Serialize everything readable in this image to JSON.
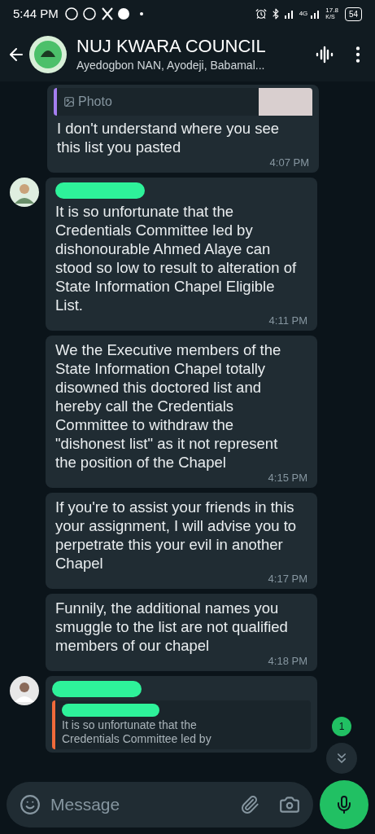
{
  "status_bar": {
    "time": "5:44 PM",
    "network": "4G",
    "speed": "17.8",
    "speed_unit": "K/S",
    "battery": "54"
  },
  "header": {
    "title": "NUJ KWARA COUNCIL",
    "subtitle": "Ayedogbon NAN, Ayodeji, Babamal..."
  },
  "messages": [
    {
      "kind": "quoted_photo",
      "quote_label": "Photo",
      "text": "I don't understand where you see this list you pasted",
      "time": "4:07 PM"
    },
    {
      "kind": "first",
      "redacted_name": true,
      "text": "It is so unfortunate that the Credentials Committee led by dishonourable Ahmed Alaye can stood so low to result to alteration of State Information Chapel Eligible List.",
      "time": "4:11 PM"
    },
    {
      "kind": "plain",
      "text": "We the Executive members of the State Information Chapel totally disowned this doctored list and hereby call the Credentials Committee to withdraw the \"dishonest list\" as it not represent the position of the Chapel",
      "time": "4:15 PM"
    },
    {
      "kind": "plain",
      "text": "If you're to assist your friends in this your assignment, I will advise you to perpetrate this your evil in another Chapel",
      "time": "4:17 PM"
    },
    {
      "kind": "plain",
      "text": "Funnily, the additional names you smuggle to the list are not qualified members of our chapel",
      "time": "4:18 PM"
    },
    {
      "kind": "reply",
      "redacted_name": true,
      "quote_lines": [
        "It is so unfortunate that the",
        "Credentials Committee led by"
      ]
    }
  ],
  "unread_badge": "1",
  "composer": {
    "placeholder": "Message"
  }
}
